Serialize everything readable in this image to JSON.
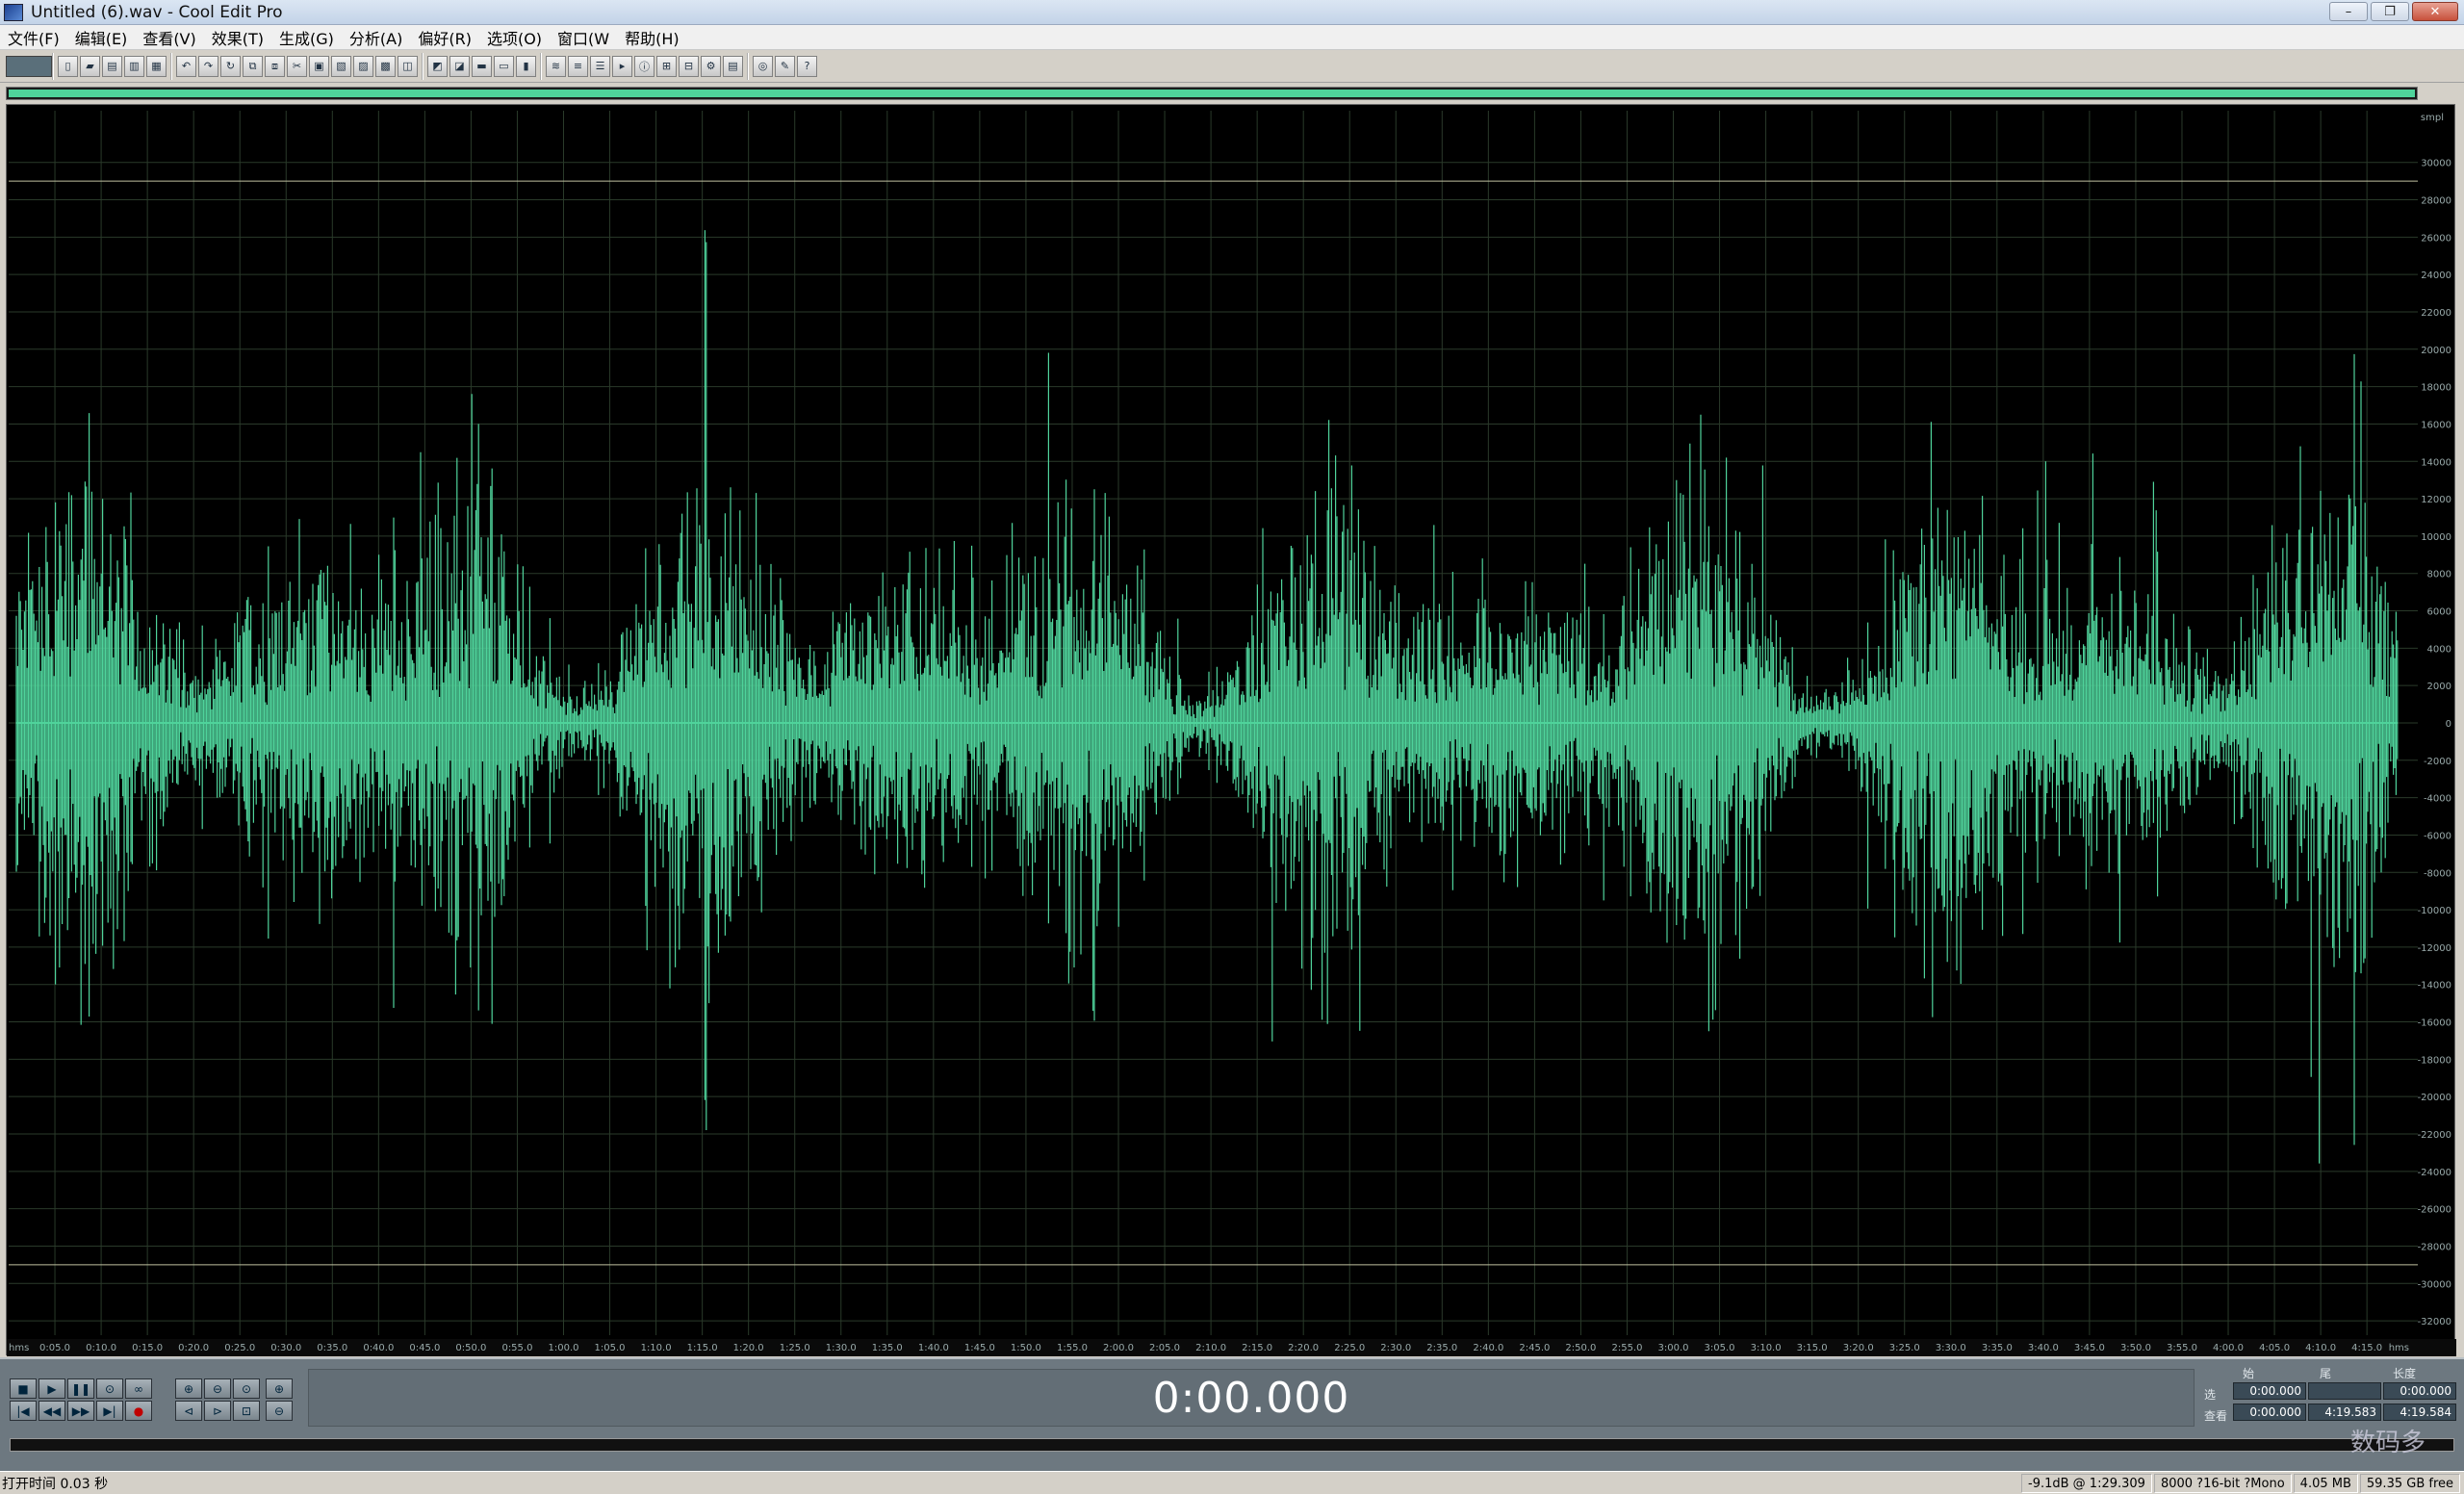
{
  "window": {
    "title": "Untitled (6).wav - Cool Edit Pro",
    "minimize": "–",
    "maximize": "❐",
    "close": "✕"
  },
  "menu": [
    "文件(F)",
    "编辑(E)",
    "查看(V)",
    "效果(T)",
    "生成(G)",
    "分析(A)",
    "偏好(R)",
    "选项(O)",
    "窗口(W",
    "帮助(H)"
  ],
  "time_ruler": {
    "unit_left": "hms",
    "unit_right": "hms",
    "ticks": [
      "0:05.0",
      "0:10.0",
      "0:15.0",
      "0:20.0",
      "0:25.0",
      "0:30.0",
      "0:35.0",
      "0:40.0",
      "0:45.0",
      "0:50.0",
      "0:55.0",
      "1:00.0",
      "1:05.0",
      "1:10.0",
      "1:15.0",
      "1:20.0",
      "1:25.0",
      "1:30.0",
      "1:35.0",
      "1:40.0",
      "1:45.0",
      "1:50.0",
      "1:55.0",
      "2:00.0",
      "2:05.0",
      "2:10.0",
      "2:15.0",
      "2:20.0",
      "2:25.0",
      "2:30.0",
      "2:35.0",
      "2:40.0",
      "2:45.0",
      "2:50.0",
      "2:55.0",
      "3:00.0",
      "3:05.0",
      "3:10.0",
      "3:15.0",
      "3:20.0",
      "3:25.0",
      "3:30.0",
      "3:35.0",
      "3:40.0",
      "3:45.0",
      "3:50.0",
      "3:55.0",
      "4:00.0",
      "4:05.0",
      "4:10.0",
      "4:15.0"
    ]
  },
  "amplitude_ruler": {
    "unit": "smpl",
    "ticks": [
      "30000",
      "28000",
      "26000",
      "24000",
      "22000",
      "20000",
      "18000",
      "16000",
      "14000",
      "12000",
      "10000",
      "8000",
      "6000",
      "4000",
      "2000",
      "0",
      "-2000",
      "-4000",
      "-6000",
      "-8000",
      "-10000",
      "-12000",
      "-14000",
      "-16000",
      "-18000",
      "-20000",
      "-22000",
      "-24000",
      "-26000",
      "-28000",
      "-30000",
      "-32000"
    ]
  },
  "waveform": {
    "color": "#4fd39b",
    "background": "#000000",
    "grid_color": "#2a3a2a",
    "amplitude_min": -32768,
    "amplitude_max": 32767,
    "duration": "4:19.584"
  },
  "transport": {
    "row1": [
      "■",
      "▶",
      "❚❚",
      "⊙",
      "∞"
    ],
    "row2": [
      "|◀",
      "◀◀",
      "▶▶",
      "▶|",
      "●"
    ]
  },
  "time_display": "0:00.000",
  "selection": {
    "col_start": "始",
    "col_end": "尾",
    "col_length": "长度",
    "row_sel_label": "选",
    "row_view_label": "查看",
    "sel_start": "0:00.000",
    "sel_end": "",
    "sel_length": "0:00.000",
    "view_start": "0:00.000",
    "view_end": "4:19.583",
    "view_length": "4:19.584"
  },
  "status": {
    "left": "打开时间 0.03 秒",
    "level": "-9.1dB @ 1:29.309",
    "format": "8000 ?16-bit ?Mono",
    "size": "4.05 MB",
    "free": "59.35 GB free"
  },
  "watermark": "数码多"
}
